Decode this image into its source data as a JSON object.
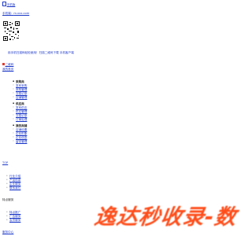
{
  "header": {
    "mobile_label": "手机版",
    "mobile_url_prefix": "手机端：",
    "mobile_url": "m.xxx.com"
  },
  "qr_row": {
    "text": "用手机扫描码轻松使用！扫描二维码下载 手机客户端"
  },
  "links": {
    "qr_link": "二维码",
    "my_home": "我的首页"
  },
  "sidebar": {
    "groups": [
      {
        "title": "采购商",
        "items": [
          "发布采购",
          "采购管理",
          "交易记录",
          "店铺管理"
        ]
      },
      {
        "title": "供应商",
        "items": [
          "发布供应",
          "供应管理",
          "交易记录",
          "订单处理"
        ]
      },
      {
        "title": "我的商铺",
        "items": [
          "店铺设置",
          "企业形象",
          "企业信息",
          "留言管理"
        ]
      }
    ]
  },
  "toggle": {
    "label": "TOP"
  },
  "nav_list": {
    "items": [
      "行业介绍",
      "产品信息",
      "企业服务",
      "联系我们"
    ]
  },
  "section_title": "特点服务",
  "service_list": {
    "items": [
      "特点推广",
      "广告服务",
      "会员服务"
    ]
  },
  "footer_link": "服务中心",
  "watermark": {
    "text": "逸达秒收录-数"
  },
  "colors": {
    "link": "#1a37c8",
    "text": "#222222",
    "watermark": "#ff4d1a",
    "flag": "#e23a2c"
  }
}
